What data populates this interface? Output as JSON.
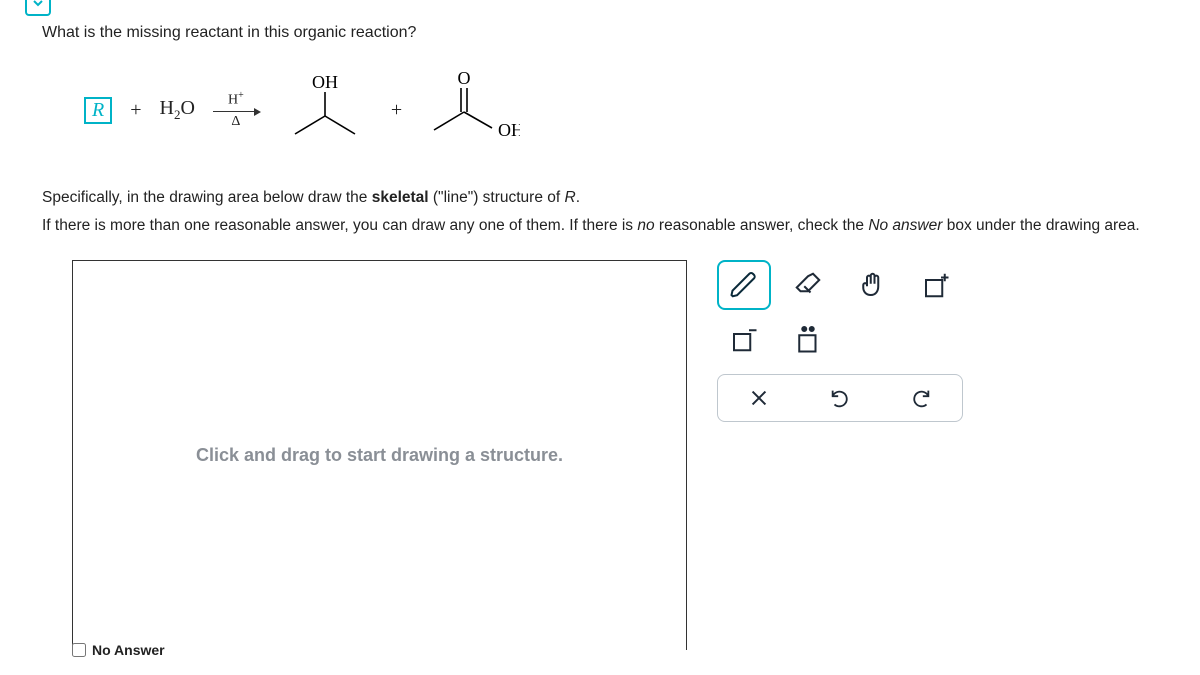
{
  "question": {
    "prompt": "What is the missing reactant in this organic reaction?",
    "instruction1_pre": "Specifically, in the drawing area below draw the ",
    "instruction1_bold": "skeletal",
    "instruction1_post": " (\"line\") structure of ",
    "instruction1_var": "R",
    "instruction1_end": ".",
    "instruction2_pre": "If there is more than one reasonable answer, you can draw any one of them. If there is ",
    "instruction2_ital1": "no",
    "instruction2_mid": " reasonable answer, check the ",
    "instruction2_ital2": "No answer",
    "instruction2_post": " box under the drawing area."
  },
  "reaction": {
    "reactant_box": "R",
    "plus1": "+",
    "water": "H2O",
    "arrow_top": "H+",
    "arrow_bottom": "Δ",
    "plus2": "+",
    "product1_label_top": "OH",
    "product2_label_top": "O",
    "product2_label_side": "OH"
  },
  "canvas": {
    "hint": "Click and drag to start drawing a structure."
  },
  "tools": {
    "pencil": "pencil-icon",
    "eraser": "eraser-icon",
    "grab": "hand-icon",
    "charge_plus": "box-plus-icon",
    "charge_minus": "box-minus-icon",
    "lone_pair": "box-dots-icon",
    "clear": "×",
    "undo": "undo-icon",
    "redo": "redo-icon"
  },
  "no_answer_label": "No Answer"
}
